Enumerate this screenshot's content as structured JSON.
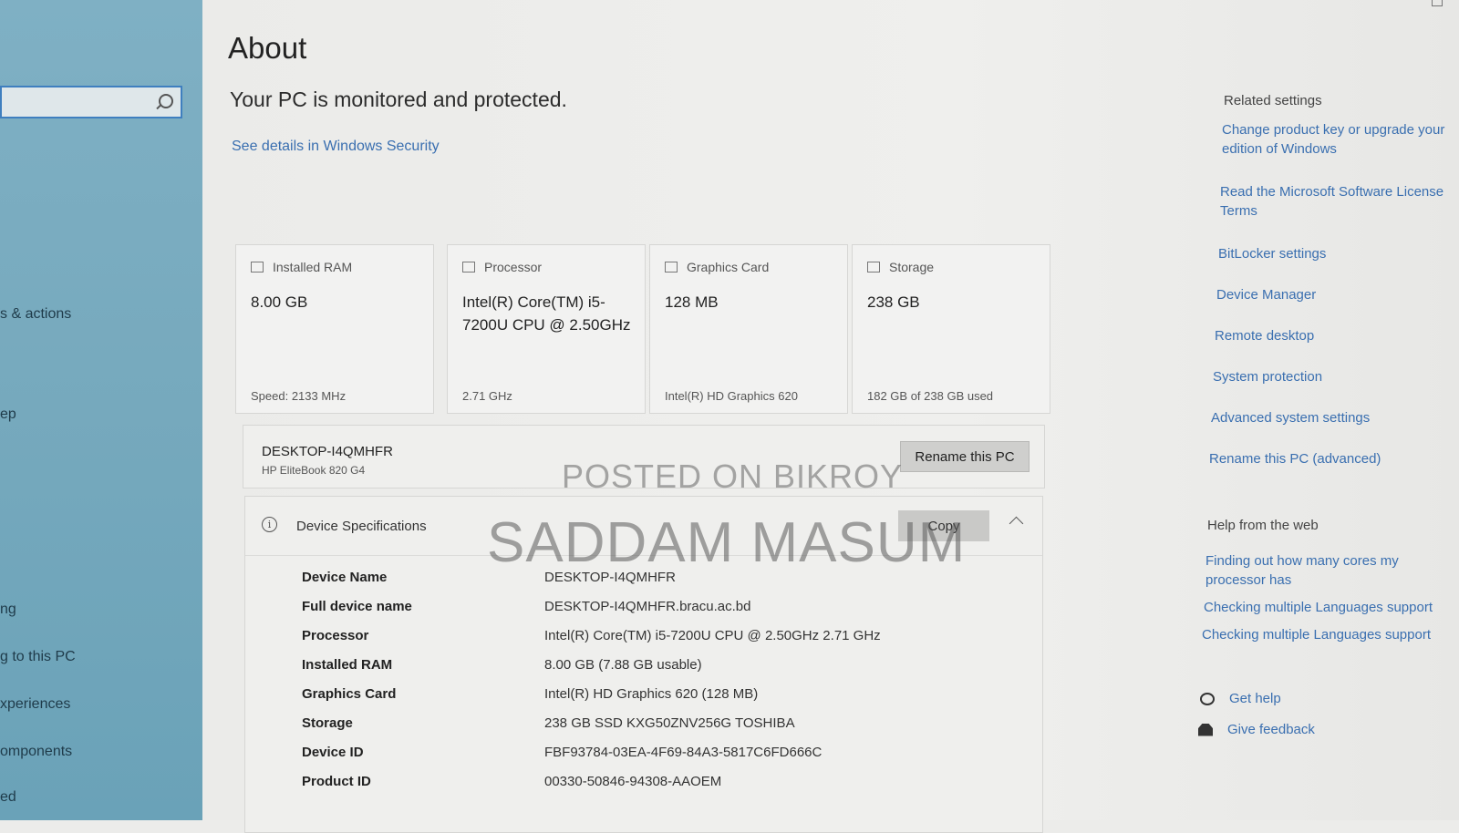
{
  "sidebar": {
    "search_placeholder": "",
    "items": [
      {
        "label": "s & actions"
      },
      {
        "label": "ep"
      },
      {
        "label": "ng"
      },
      {
        "label": "g to this PC"
      },
      {
        "label": "xperiences"
      },
      {
        "label": "omponents"
      },
      {
        "label": "ed"
      }
    ]
  },
  "main": {
    "title": "About",
    "protection_text": "Your PC is monitored and protected.",
    "security_link": "See details in Windows Security"
  },
  "cards": [
    {
      "icon": "ram-icon",
      "title": "Installed RAM",
      "value": "8.00 GB",
      "sub": "Speed: 2133 MHz"
    },
    {
      "icon": "processor-icon",
      "title": "Processor",
      "value": "Intel(R) Core(TM) i5-7200U CPU @ 2.50GHz",
      "sub": "2.71 GHz"
    },
    {
      "icon": "graphics-card-icon",
      "title": "Graphics Card",
      "value": "128 MB",
      "sub": "Intel(R) HD Graphics 620"
    },
    {
      "icon": "storage-icon",
      "title": "Storage",
      "value": "238 GB",
      "sub": "182 GB of 238 GB used"
    }
  ],
  "pc": {
    "name": "DESKTOP-I4QMHFR",
    "model": "HP EliteBook 820 G4",
    "rename_label": "Rename this PC"
  },
  "specs": {
    "title": "Device Specifications",
    "copy_label": "Copy",
    "rows": [
      {
        "label": "Device Name",
        "value": "DESKTOP-I4QMHFR"
      },
      {
        "label": "Full device name",
        "value": "DESKTOP-I4QMHFR.bracu.ac.bd"
      },
      {
        "label": "Processor",
        "value": "Intel(R) Core(TM) i5-7200U CPU @ 2.50GHz   2.71 GHz"
      },
      {
        "label": "Installed RAM",
        "value": "8.00 GB (7.88 GB usable)"
      },
      {
        "label": "Graphics Card",
        "value": "Intel(R) HD Graphics 620 (128 MB)"
      },
      {
        "label": "Storage",
        "value": "238 GB SSD KXG50ZNV256G TOSHIBA"
      },
      {
        "label": "Device ID",
        "value": "FBF93784-03EA-4F69-84A3-5817C6FD666C"
      },
      {
        "label": "Product ID",
        "value": "00330-50846-94308-AAOEM"
      }
    ]
  },
  "watermark": {
    "line1": "POSTED ON BIKROY",
    "line2": "SADDAM MASUM"
  },
  "related": {
    "heading": "Related settings",
    "links": [
      "Change product key or upgrade your edition of Windows",
      "Read the Microsoft Software License Terms",
      "BitLocker settings",
      "Device Manager",
      "Remote desktop",
      "System protection",
      "Advanced system settings",
      "Rename this PC (advanced)"
    ],
    "help_heading": "Help from the web",
    "help_links": [
      "Finding out how many cores my processor has",
      "Checking multiple Languages support",
      "Checking multiple Languages support"
    ],
    "get_help": "Get help",
    "give_feedback": "Give feedback"
  },
  "colors": {
    "link": "#3a6fb0",
    "sidebar": "#76a9bd",
    "search_border": "#3f7fbf"
  }
}
